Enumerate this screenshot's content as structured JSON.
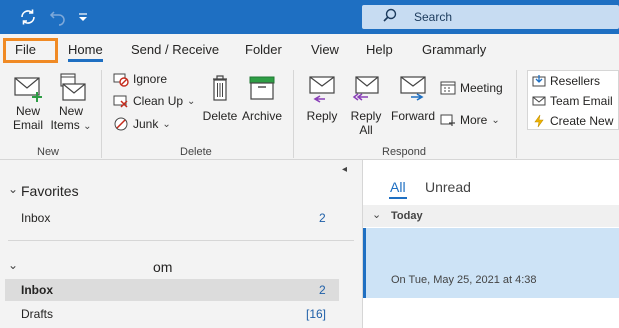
{
  "search": {
    "placeholder": "Search"
  },
  "tabs": [
    {
      "label": "File"
    },
    {
      "label": "Home"
    },
    {
      "label": "Send / Receive"
    },
    {
      "label": "Folder"
    },
    {
      "label": "View"
    },
    {
      "label": "Help"
    },
    {
      "label": "Grammarly"
    }
  ],
  "ribbon": {
    "new": {
      "new_email": "New",
      "new_email2": "Email",
      "new_items": "New",
      "new_items2": "Items",
      "group": "New"
    },
    "delete": {
      "ignore": "Ignore",
      "cleanup": "Clean Up",
      "junk": "Junk",
      "delete": "Delete",
      "archive": "Archive",
      "group": "Delete"
    },
    "respond": {
      "reply": "Reply",
      "reply_all": "Reply",
      "reply_all2": "All",
      "forward": "Forward",
      "meeting": "Meeting",
      "more": "More",
      "group": "Respond"
    },
    "quick_steps": [
      "Resellers",
      "Team Email",
      "Create New"
    ]
  },
  "folders": {
    "favorites_header": "Favorites",
    "favorites": [
      {
        "name": "Inbox",
        "count": "2"
      }
    ],
    "account_header": "om",
    "account_folders": [
      {
        "name": "Inbox",
        "count": "2"
      },
      {
        "name": "Drafts",
        "count": "[16]"
      }
    ]
  },
  "message_list": {
    "filters": [
      "All",
      "Unread"
    ],
    "group": "Today",
    "message": {
      "date": "On Tue, May 25, 2021 at 4:38"
    }
  },
  "colors": {
    "accent": "#1e6fc2",
    "file_highlight": "#f08a24",
    "selected_message": "#cde3f6"
  }
}
